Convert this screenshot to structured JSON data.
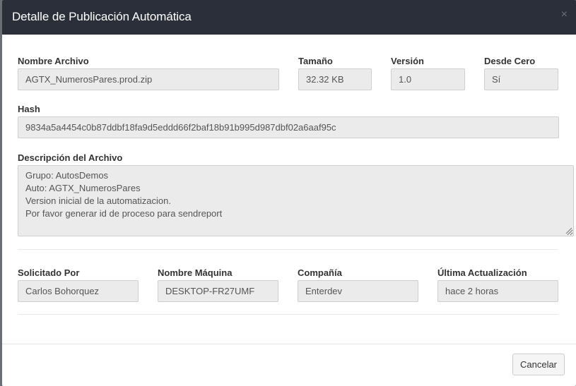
{
  "modal": {
    "title": "Detalle de Publicación Automática",
    "close_glyph": "×"
  },
  "file": {
    "name_label": "Nombre Archivo",
    "name_value": "AGTX_NumerosPares.prod.zip",
    "size_label": "Tamaño",
    "size_value": "32.32 KB",
    "version_label": "Versión",
    "version_value": "1.0",
    "from_scratch_label": "Desde Cero",
    "from_scratch_value": "Sí",
    "hash_label": "Hash",
    "hash_value": "9834a5a4454c0b87ddbf18fa9d5eddd66f2baf18b91b995d987dbf02a6aaf95c",
    "description_label": "Descripción del Archivo",
    "description_value": "Grupo: AutosDemos\nAuto: AGTX_NumerosPares\nVersion inicial de la automatizacion.\nPor favor generar id de proceso para sendreport"
  },
  "request": {
    "requested_by_label": "Solicitado Por",
    "requested_by_value": "Carlos Bohorquez",
    "machine_label": "Nombre Máquina",
    "machine_value": "DESKTOP-FR27UMF",
    "company_label": "Compañía",
    "company_value": "Enterdev",
    "last_update_label": "Última Actualización",
    "last_update_value": "hace 2 horas"
  },
  "footer": {
    "cancel_label": "Cancelar"
  },
  "colors": {
    "header_bg": "#2b2f3a",
    "field_bg": "#ebebeb"
  }
}
